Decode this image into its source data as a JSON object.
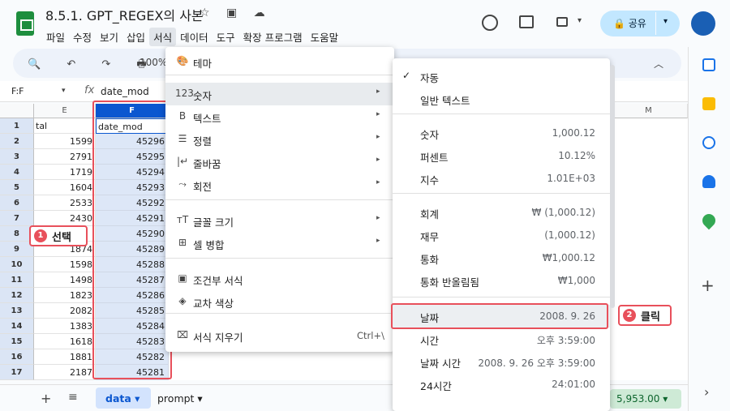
{
  "app": {
    "title": "8.5.1. GPT_REGEX의 사본",
    "title_icons": "☆ ▣ ☁",
    "share_label": "공유",
    "share_caret": "▾",
    "cam_caret": "▾"
  },
  "menubar": [
    "파일",
    "수정",
    "보기",
    "삽입",
    "서식",
    "데이터",
    "도구",
    "확장 프로그램",
    "도움말"
  ],
  "toolbar": {
    "icons": "🔍 ↶ ↷ 🖶 ⚲",
    "zoom": "100%",
    "collapse": "︿"
  },
  "formula_bar": {
    "name_box": "F:F",
    "name_caret": "▾",
    "fx": "fx",
    "value": "date_mod"
  },
  "grid": {
    "col_headers": [
      "E",
      "F",
      "",
      "",
      "",
      "",
      "",
      "",
      "M"
    ],
    "rows": [
      {
        "num": "1",
        "e": "tal",
        "f": "date_mod"
      },
      {
        "num": "2",
        "e": "1599",
        "f": "45296"
      },
      {
        "num": "3",
        "e": "2791",
        "f": "45295"
      },
      {
        "num": "4",
        "e": "1719",
        "f": "45294"
      },
      {
        "num": "5",
        "e": "1604",
        "f": "45293"
      },
      {
        "num": "6",
        "e": "2533",
        "f": "45292"
      },
      {
        "num": "7",
        "e": "2430",
        "f": "45291"
      },
      {
        "num": "8",
        "e": "",
        "f": "45290"
      },
      {
        "num": "9",
        "e": "1874",
        "f": "45289"
      },
      {
        "num": "10",
        "e": "1598",
        "f": "45288"
      },
      {
        "num": "11",
        "e": "1498",
        "f": "45287"
      },
      {
        "num": "12",
        "e": "1823",
        "f": "45286"
      },
      {
        "num": "13",
        "e": "2082",
        "f": "45285"
      },
      {
        "num": "14",
        "e": "1383",
        "f": "45284"
      },
      {
        "num": "15",
        "e": "1618",
        "f": "45283"
      },
      {
        "num": "16",
        "e": "1881",
        "f": "45282"
      },
      {
        "num": "17",
        "e": "2187",
        "f": "45281"
      }
    ]
  },
  "annotations": {
    "step1_num": "1",
    "step1_text": "선택",
    "step2_num": "2",
    "step2_text": "클릭"
  },
  "format_menu": {
    "items": [
      {
        "icon": "🎨",
        "label": "테마"
      },
      {
        "icon": "123",
        "label": "숫자",
        "arrow": "▸"
      },
      {
        "icon": "B",
        "label": "텍스트",
        "arrow": "▸"
      },
      {
        "icon": "☰",
        "label": "정렬",
        "arrow": "▸"
      },
      {
        "icon": "|↵",
        "label": "줄바꿈",
        "arrow": "▸"
      },
      {
        "icon": "⤳",
        "label": "회전",
        "arrow": "▸"
      },
      {
        "icon": "тT",
        "label": "글꼴 크기",
        "arrow": "▸"
      },
      {
        "icon": "⊞",
        "label": "셀 병합",
        "arrow": "▸"
      },
      {
        "icon": "▣",
        "label": "조건부 서식"
      },
      {
        "icon": "◈",
        "label": "교차 색상"
      },
      {
        "icon": "⌧",
        "label": "서식 지우기",
        "shortcut": "Ctrl+\\"
      }
    ]
  },
  "number_submenu": {
    "items": [
      {
        "check": "✓",
        "label": "자동",
        "value": ""
      },
      {
        "check": "",
        "label": "일반 텍스트",
        "value": ""
      },
      {
        "check": "",
        "label": "숫자",
        "value": "1,000.12"
      },
      {
        "check": "",
        "label": "퍼센트",
        "value": "10.12%"
      },
      {
        "check": "",
        "label": "지수",
        "value": "1.01E+03"
      },
      {
        "check": "",
        "label": "회계",
        "value": "₩ (1,000.12)"
      },
      {
        "check": "",
        "label": "재무",
        "value": "(1,000.12)"
      },
      {
        "check": "",
        "label": "통화",
        "value": "₩1,000.12"
      },
      {
        "check": "",
        "label": "통화 반올림됨",
        "value": "₩1,000"
      },
      {
        "check": "",
        "label": "날짜",
        "value": "2008. 9. 26"
      },
      {
        "check": "",
        "label": "시간",
        "value": "오후 3:59:00"
      },
      {
        "check": "",
        "label": "날짜 시간",
        "value": "2008. 9. 26 오후 3:59:00"
      },
      {
        "check": "",
        "label": "24시간",
        "value": "24:01:00"
      }
    ]
  },
  "sheet_tabs": {
    "plus": "+",
    "list": "≡",
    "active": "data ▾",
    "other": "prompt ▾",
    "sum": "5,953.00 ▾"
  },
  "side_panel": {
    "expand": "›",
    "add": "+"
  },
  "colors": {
    "accent": "#0b57d0",
    "annotation_red": "#e8505b",
    "share_bg": "#c2e7ff"
  }
}
